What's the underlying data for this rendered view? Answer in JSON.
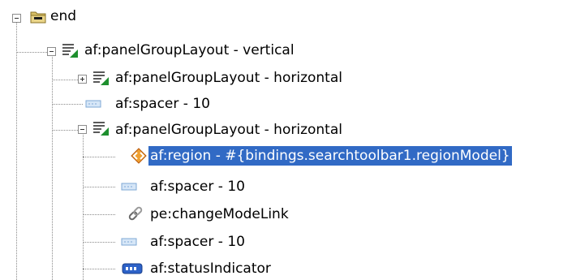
{
  "tree": {
    "nodes": [
      {
        "label": "end",
        "icon": "folder-icon",
        "toggle": "minus"
      },
      {
        "label": "af:panelGroupLayout - vertical",
        "icon": "panel-group-layout-icon",
        "toggle": "minus"
      },
      {
        "label": "af:panelGroupLayout - horizontal",
        "icon": "panel-group-layout-icon",
        "toggle": "plus"
      },
      {
        "label": "af:spacer - 10",
        "icon": "spacer-icon",
        "toggle": "none"
      },
      {
        "label": "af:panelGroupLayout - horizontal",
        "icon": "panel-group-layout-icon",
        "toggle": "minus"
      },
      {
        "label": "af:region - #{bindings.searchtoolbar1.regionModel}",
        "icon": "region-icon",
        "toggle": "none",
        "selected": true
      },
      {
        "label": "af:spacer - 10",
        "icon": "spacer-icon",
        "toggle": "none"
      },
      {
        "label": "pe:changeModeLink",
        "icon": "link-icon",
        "toggle": "none"
      },
      {
        "label": "af:spacer - 10",
        "icon": "spacer-icon",
        "toggle": "none"
      },
      {
        "label": "af:statusIndicator",
        "icon": "status-indicator-icon",
        "toggle": "none"
      }
    ]
  },
  "colors": {
    "selection": "#316ac5",
    "folder": "#c8a94a",
    "layout_green": "#1e8f2e",
    "region_orange": "#e06a1a",
    "spacer_blue": "#7fa8d6",
    "status_blue": "#2d62c8"
  }
}
